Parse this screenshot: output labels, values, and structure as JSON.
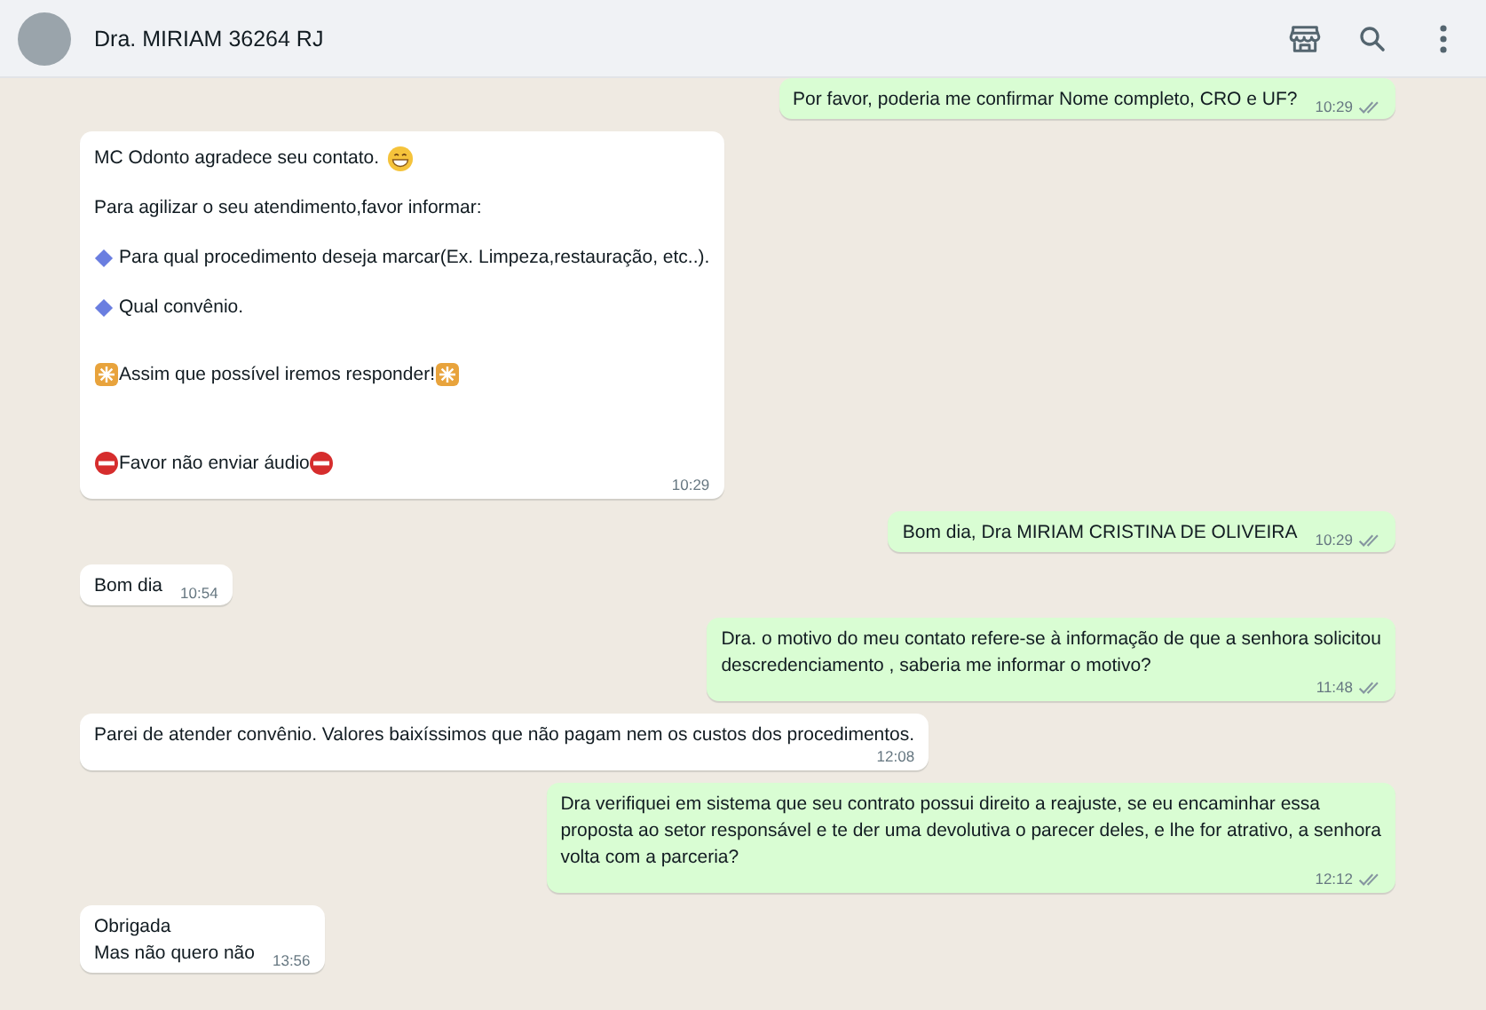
{
  "header": {
    "contact_name": "Dra. MIRIAM 36264 RJ"
  },
  "messages": [
    {
      "kind": "out",
      "lines": [
        "Por favor, poderia me confirmar Nome completo, CRO e UF?"
      ],
      "time": "10:29",
      "read": false
    },
    {
      "kind": "in",
      "lines": [
        {
          "kind": "greeting",
          "text": "MC Odonto agradece seu contato."
        },
        {
          "kind": "plain",
          "text": "Para agilizar o seu atendimento,favor informar:"
        },
        {
          "kind": "bullet",
          "text": " Para qual procedimento deseja marcar(Ex. Limpeza,restauração, etc..)."
        },
        {
          "kind": "bullet",
          "text": "Qual convênio."
        },
        {
          "kind": "highlight",
          "text": "Assim que possível iremos responder!"
        },
        {
          "kind": "warning",
          "text": "Favor não enviar áudio"
        }
      ],
      "time": "10:29"
    },
    {
      "kind": "out",
      "lines": [
        "Bom dia, Dra MIRIAM CRISTINA DE OLIVEIRA"
      ],
      "time": "10:29",
      "read": false
    },
    {
      "kind": "in",
      "lines": [
        "Bom dia"
      ],
      "time": "10:54"
    },
    {
      "kind": "out",
      "lines": [
        "Dra. o motivo do meu contato refere-se à informação de que a senhora solicitou",
        "descredenciamento , saberia me informar o motivo?"
      ],
      "time": "11:48",
      "read": false
    },
    {
      "kind": "in",
      "lines": [
        "Parei de atender convênio. Valores baixíssimos que não pagam nem os custos dos procedimentos."
      ],
      "time": "12:08"
    },
    {
      "kind": "out",
      "lines": [
        "Dra verifiquei em sistema que seu contrato possui direito a reajuste, se eu encaminhar essa",
        "proposta ao setor responsável e te der uma devolutiva o parecer deles, e lhe for atrativo, a senhora",
        "volta com a parceria?"
      ],
      "time": "12:12",
      "read": false
    },
    {
      "kind": "in",
      "lines": [
        "Obrigada",
        "Mas não quero não"
      ],
      "time": "13:56"
    }
  ]
}
